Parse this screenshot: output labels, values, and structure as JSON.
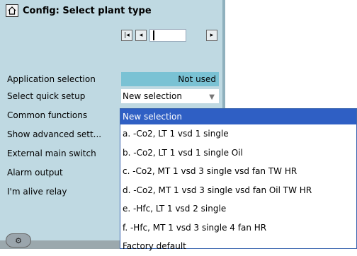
{
  "header": {
    "title": "Config: Select plant type"
  },
  "icons": {
    "home": "home-icon",
    "first": "skip-first-icon",
    "prev": "step-back-icon",
    "next": "step-forward-icon",
    "tool": "device-icon"
  },
  "rows": [
    {
      "label": "Application selection"
    },
    {
      "label": "Select quick setup"
    },
    {
      "label": "Common functions"
    },
    {
      "label": "Show advanced sett..."
    },
    {
      "label": "External main switch"
    },
    {
      "label": "Alarm output"
    },
    {
      "label": "I'm alive relay"
    }
  ],
  "values": {
    "application": "Not used",
    "quick_setup": "New selection"
  },
  "dropdown": {
    "options": [
      "New selection",
      "a. -Co2, LT 1 vsd 1 single",
      "b. -Co2, LT 1 vsd 1 single Oil",
      "c. -Co2, MT 1 vsd 3 single vsd fan TW HR",
      "d. -Co2, MT 1 vsd 3 single vsd fan Oil TW HR",
      "e. -Hfc, LT 1 vsd 2 single",
      "f. -Hfc, MT 1 vsd 3 single 4 fan HR",
      "Factory default"
    ]
  },
  "colors": {
    "panel": "#bfd9e2",
    "highlight": "#7ac2d4",
    "selection": "#2f5fc4"
  }
}
